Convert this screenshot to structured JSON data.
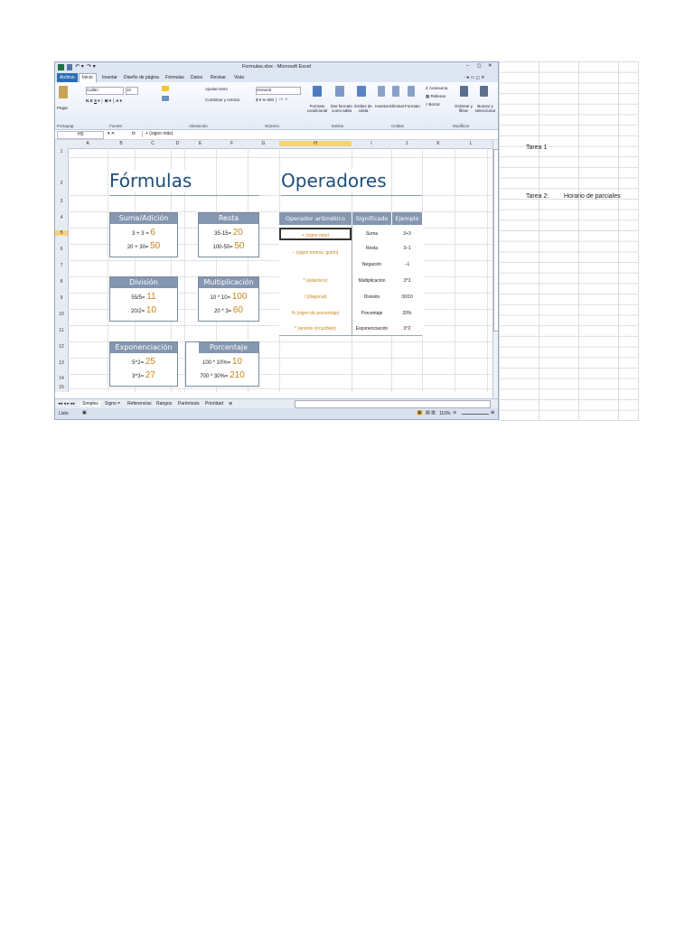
{
  "window": {
    "title": "Formulas.xlsx  -  Microsoft Excel",
    "controls": [
      "–",
      "◻",
      "✕"
    ]
  },
  "menu": {
    "file": "Archivo",
    "tabs": [
      "Inicio",
      "Insertar",
      "Diseño de página",
      "Fórmulas",
      "Datos",
      "Revisar",
      "Vista"
    ]
  },
  "ribbon": {
    "paste": "Pegar",
    "font_name": "Calibri",
    "font_size": "10",
    "wrap_text": "Ajustar texto",
    "merge_center": "Combinar y centrar",
    "number_format": "General",
    "conditional": "Formato condicional",
    "as_table": "Dar formato como tabla",
    "cell_styles": "Estilos de celda",
    "insert": "Insertar",
    "delete": "Eliminar",
    "format": "Formato",
    "autosum": "Autosuma",
    "fill": "Rellenar",
    "clear": "Borrar",
    "sort_filter": "Ordenar y filtrar",
    "find_select": "Buscar y seleccionar",
    "groups": [
      "Portapap.",
      "Fuente",
      "Alineación",
      "Número",
      "Estilos",
      "Celdas",
      "Modificar"
    ]
  },
  "formula_bar": {
    "name_box": "H5",
    "fx": "fx",
    "content": "+ (signo más)"
  },
  "columns": [
    "A",
    "B",
    "C",
    "D",
    "E",
    "F",
    "G",
    "H",
    "I",
    "J",
    "K",
    "L"
  ],
  "rows": [
    "1",
    "2",
    "3",
    "4",
    "5",
    "6",
    "7",
    "8",
    "9",
    "10",
    "11",
    "12",
    "13",
    "14",
    "15"
  ],
  "titles": {
    "formulas": "Fórmulas",
    "operators": "Operadores"
  },
  "formula_blocks": [
    {
      "header": "Suma/Adición",
      "lines": [
        {
          "expr": "3 + 3 =",
          "result": "6"
        },
        {
          "expr": "20 + 30=",
          "result": "50"
        }
      ]
    },
    {
      "header": "Resta",
      "lines": [
        {
          "expr": "35-15=",
          "result": "20"
        },
        {
          "expr": "100-50=",
          "result": "50"
        }
      ]
    },
    {
      "header": "División",
      "lines": [
        {
          "expr": "55/5=",
          "result": "11"
        },
        {
          "expr": "20/2=",
          "result": "10"
        }
      ]
    },
    {
      "header": "Multiplicación",
      "lines": [
        {
          "expr": "10 * 10=",
          "result": "100"
        },
        {
          "expr": "20 * 3=",
          "result": "60"
        }
      ]
    },
    {
      "header": "Exponenciación",
      "lines": [
        {
          "expr": "5^2=",
          "result": "25"
        },
        {
          "expr": "3^3=",
          "result": "27"
        }
      ]
    },
    {
      "header": "Porcentaje",
      "lines": [
        {
          "expr": "100 * 10%=",
          "result": "10"
        },
        {
          "expr": "700 * 30%=",
          "result": "210"
        }
      ]
    }
  ],
  "operators_table": {
    "headers": [
      "Operador aritmético",
      "Significado",
      "Ejemplo"
    ],
    "rows": [
      {
        "op": "+ (signo más)",
        "meaning": "Suma",
        "example": "3+3"
      },
      {
        "op": "– (signo menos, guión)",
        "meaning": "Resta",
        "example": "3–1"
      },
      {
        "op": "",
        "meaning": "Negación",
        "example": "–1"
      },
      {
        "op": "* (asterisco)",
        "meaning": "Multiplicación",
        "example": "3*3"
      },
      {
        "op": "/ (diagonal)",
        "meaning": "División",
        "example": "30/10"
      },
      {
        "op": "% (signo de porcentaje)",
        "meaning": "Porcentaje",
        "example": "20%"
      },
      {
        "op": "^ (acento circunflejo)",
        "meaning": "Exponenciación",
        "example": "3^2"
      }
    ]
  },
  "sheet_tabs": [
    "Simples",
    "Signo =",
    "Referencias",
    "Rangos",
    "Paréntesis",
    "Prioridad"
  ],
  "status": {
    "ready": "Listo",
    "zoom": "110%"
  },
  "outer_sheet": {
    "tarea1": "Tarea 1",
    "tarea2": "Tarea 2:",
    "horario": "Horario de parciales"
  },
  "colors": {
    "header_fill": "#8496b0",
    "title_color": "#1f4e79",
    "result_color": "#c7841a",
    "file_tab": "#2a6db5"
  }
}
